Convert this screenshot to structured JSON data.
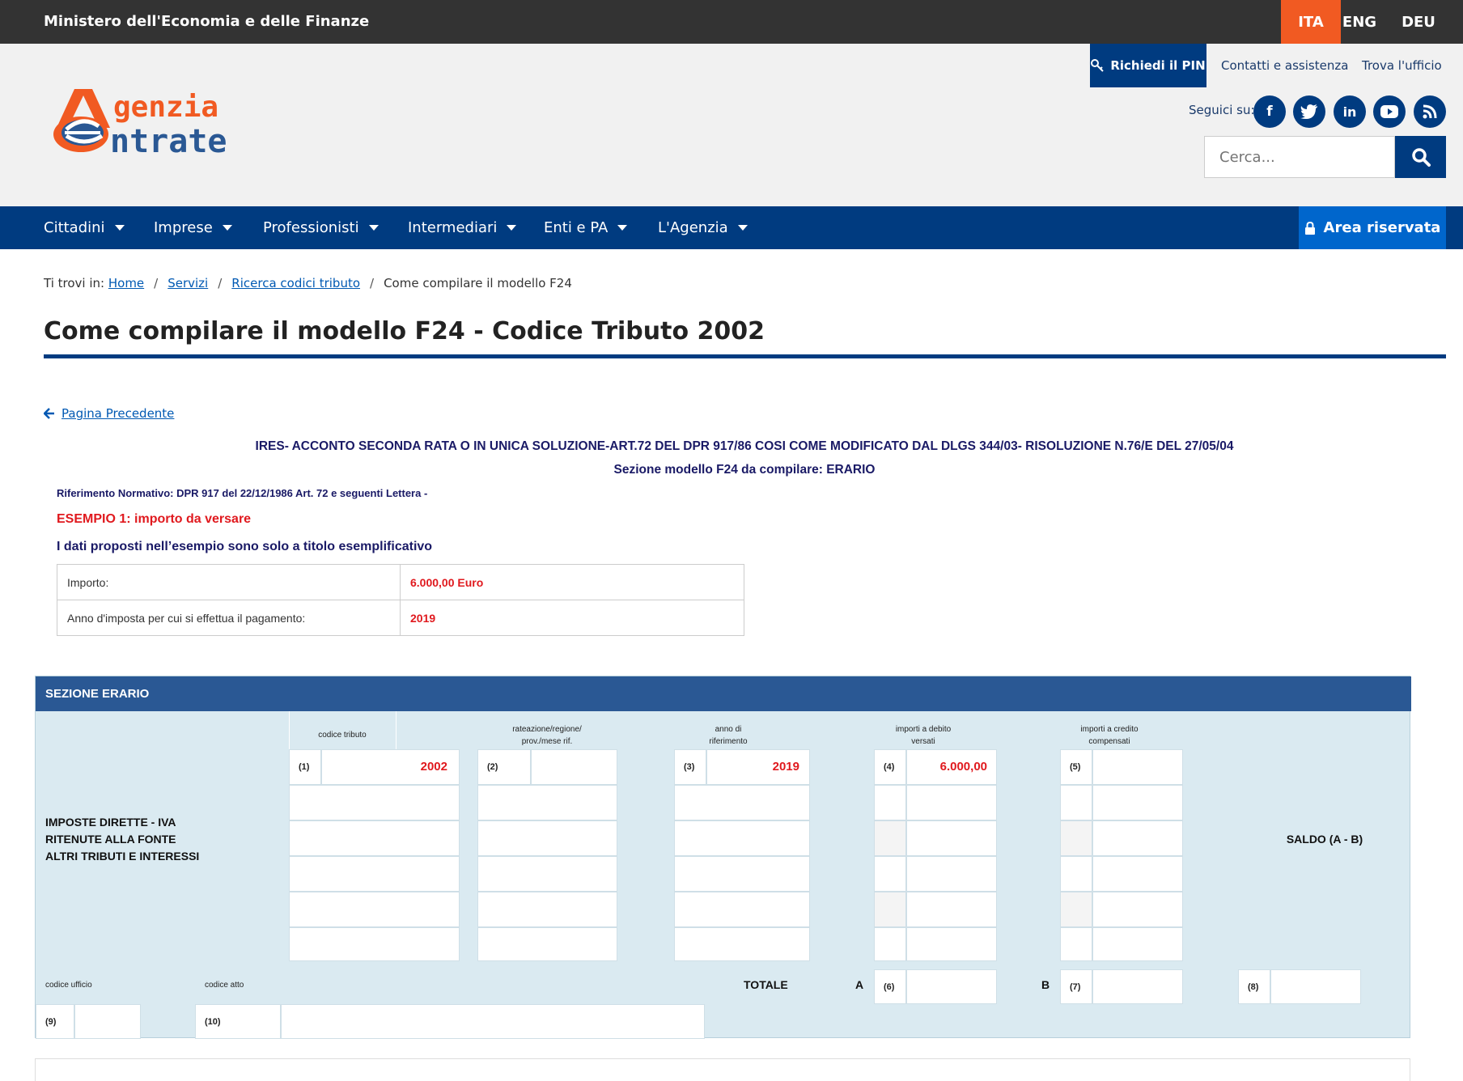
{
  "topbar": {
    "ministry": "Ministero dell'Economia e delle Finanze",
    "languages": [
      "ITA",
      "ENG",
      "DEU"
    ],
    "active_language": "ITA",
    "accent_color": "#f15a22"
  },
  "header": {
    "logo_line1": "genzia",
    "logo_line2": "ntrate",
    "pin_label": "Richiedi il PIN",
    "contatti": "Contatti e assistenza",
    "trova": "Trova l'ufficio",
    "seguici": "Seguici su:",
    "socials": [
      "facebook-icon",
      "twitter-icon",
      "linkedin-icon",
      "youtube-icon",
      "rss-icon"
    ],
    "search_placeholder": "Cerca..."
  },
  "nav": {
    "items": [
      "Cittadini",
      "Imprese",
      "Professionisti",
      "Intermediari",
      "Enti e PA",
      "L'Agenzia"
    ],
    "area_riservata": "Area riservata",
    "color": "#003b80"
  },
  "breadcrumb": {
    "prefix": "Ti trovi in:",
    "links": [
      "Home",
      "Servizi",
      "Ricerca codici tributo"
    ],
    "current": "Come compilare il modello F24"
  },
  "page": {
    "title": "Come compilare il modello F24 - Codice Tributo 2002",
    "back_link": "Pagina Precedente",
    "heading": "IRES- ACCONTO SECONDA RATA O IN UNICA SOLUZIONE-ART.72 DEL DPR 917/86 COSI COME MODIFICATO DAL DLGS 344/03- RISOLUZIONE N.76/E DEL 27/05/04",
    "subheading": "Sezione modello F24 da compilare: ERARIO",
    "riferimento": "Riferimento Normativo: DPR  917 del 22/12/1986 Art. 72 e seguenti Lettera -",
    "esempio": "ESEMPIO 1: importo da versare",
    "dati": "I dati proposti nell’esempio sono solo a titolo esemplificativo"
  },
  "info_table": {
    "rows": [
      {
        "label": "Importo:",
        "value": "6.000,00 Euro"
      },
      {
        "label": "Anno d'imposta per cui si effettua il pagamento:",
        "value": "2019"
      }
    ]
  },
  "form": {
    "title": "SEZIONE ERARIO",
    "left_label_1": "IMPOSTE DIRETTE - IVA",
    "left_label_2": "RITENUTE ALLA FONTE",
    "left_label_3": "ALTRI TRIBUTI E INTERESSI",
    "col_codice": "codice tributo",
    "col_rateazione_1": "rateazione/regione/",
    "col_rateazione_2": "prov./mese rif.",
    "col_anno_1": "anno di",
    "col_anno_2": "riferimento",
    "col_debito_1": "importi a debito",
    "col_debito_2": "versati",
    "col_credito_1": "importi a credito",
    "col_credito_2": "compensati",
    "saldo": "SALDO (A - B)",
    "n1": "(1)",
    "n2": "(2)",
    "n3": "(3)",
    "n4": "(4)",
    "n5": "(5)",
    "n6": "(6)",
    "n7": "(7)",
    "n8": "(8)",
    "n9": "(9)",
    "n10": "(10)",
    "codice_tributo_value": "2002",
    "anno_value": "2019",
    "debito_value": "6.000,00",
    "totale": "TOTALE",
    "a": "A",
    "b": "B",
    "codice_ufficio": "codice ufficio",
    "codice_atto": "codice atto"
  }
}
